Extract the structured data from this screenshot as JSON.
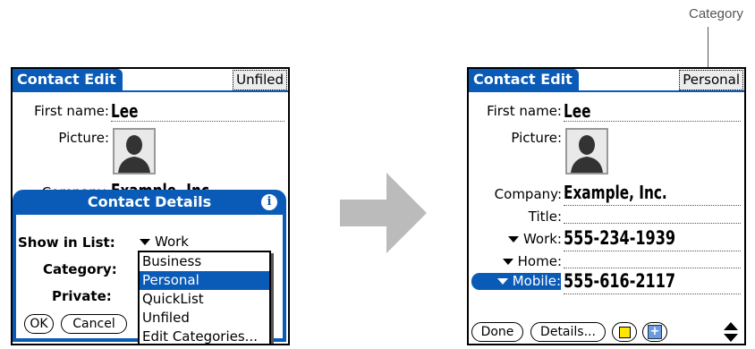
{
  "callout": {
    "text": "Category"
  },
  "left_screen": {
    "title": "Contact Edit",
    "category": "Unfiled",
    "fields": {
      "first_name_label": "First name:",
      "first_name_value": "Lee",
      "picture_label": "Picture:",
      "company_label": "Company:",
      "company_value": "Example, Inc."
    },
    "dialog": {
      "title": "Contact Details",
      "info_icon": "info-icon",
      "show_in_list_label": "Show in List:",
      "show_in_list_value": "Work",
      "category_label": "Category:",
      "private_label": "Private:",
      "ok_label": "OK",
      "cancel_label": "Cancel",
      "category_menu": {
        "items": [
          "Business",
          "Personal",
          "QuickList",
          "Unfiled",
          "Edit Categories..."
        ],
        "selected": "Personal"
      }
    }
  },
  "right_screen": {
    "title": "Contact Edit",
    "category": "Personal",
    "fields": {
      "first_name_label": "First name:",
      "first_name_value": "Lee",
      "picture_label": "Picture:",
      "company_label": "Company:",
      "company_value": "Example, Inc.",
      "title_label": "Title:",
      "work_label": "Work:",
      "work_value": "555-234-1939",
      "home_label": "Home:",
      "mobile_label": "Mobile:",
      "mobile_value": "555-616-2117"
    },
    "buttons": {
      "done_label": "Done",
      "details_label": "Details...",
      "note_icon": "note-icon",
      "new_icon": "plus-icon",
      "scroll_icon": "scroll-arrows-icon"
    }
  },
  "colors": {
    "title_blue": "#0a5bb7",
    "arrow_gray": "#bbbbbb",
    "note_yellow": "#ffe600"
  }
}
